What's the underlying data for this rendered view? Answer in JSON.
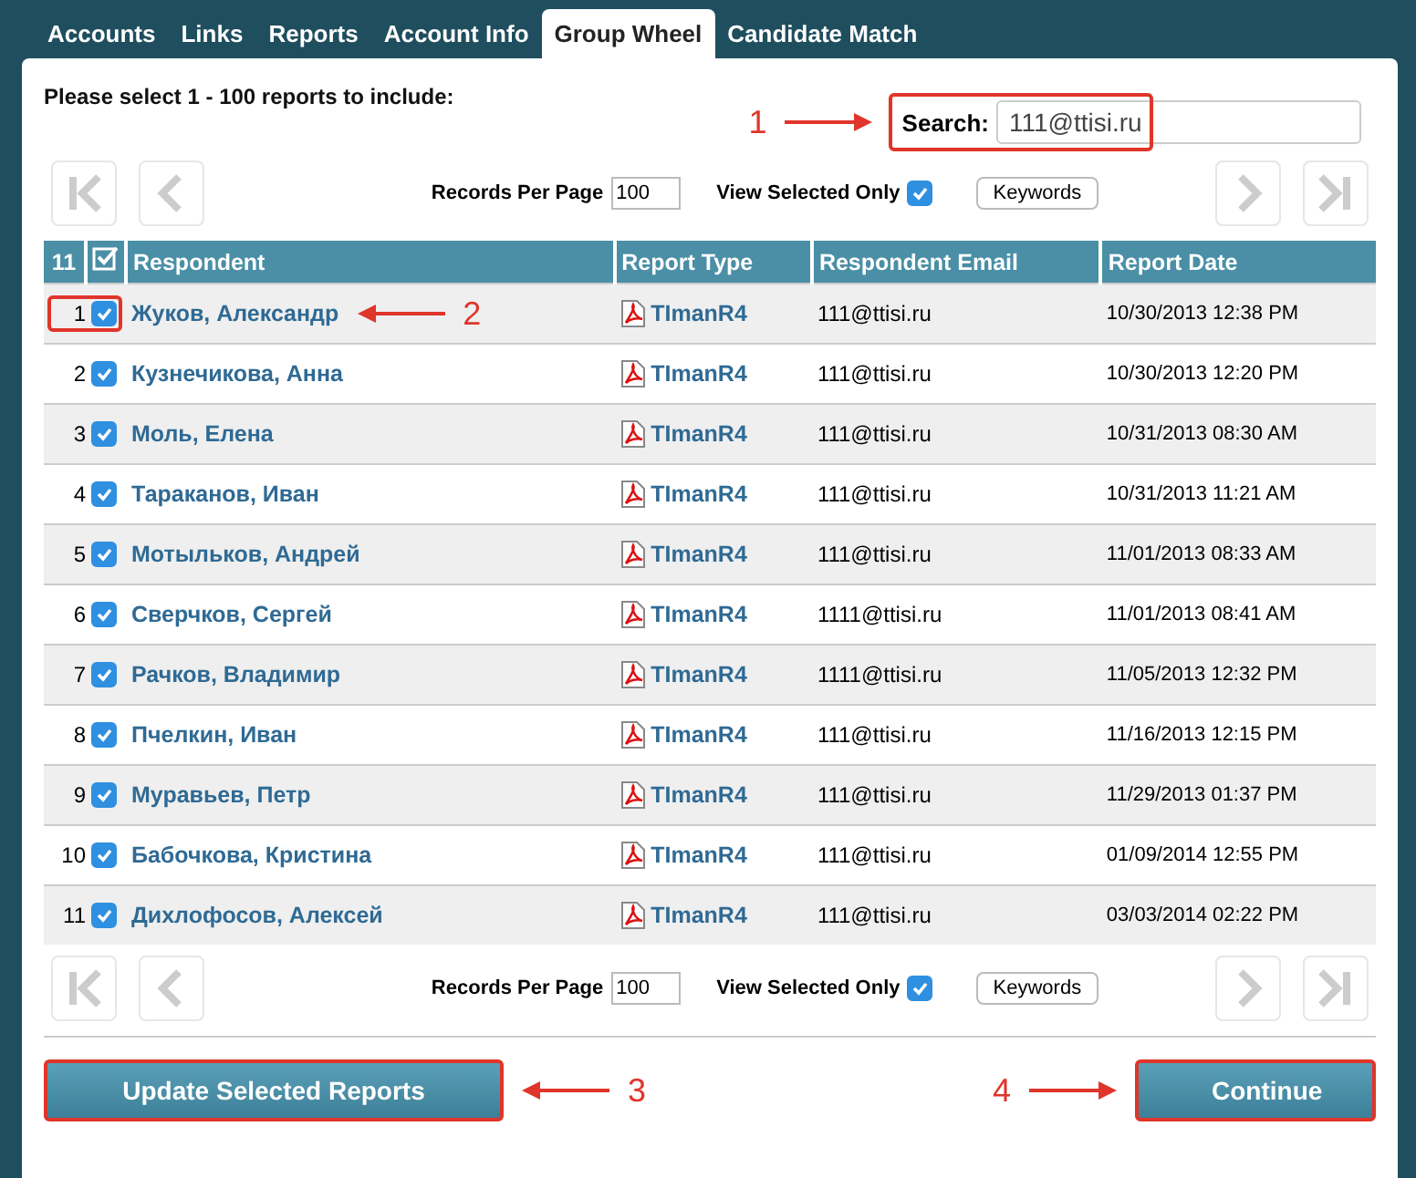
{
  "tabs": [
    {
      "label": "Accounts",
      "selected": false
    },
    {
      "label": "Links",
      "selected": false
    },
    {
      "label": "Reports",
      "selected": false
    },
    {
      "label": "Account Info",
      "selected": false
    },
    {
      "label": "Group Wheel",
      "selected": true
    },
    {
      "label": "Candidate Match",
      "selected": false
    }
  ],
  "instruction": "Please select 1 - 100 reports to include:",
  "search": {
    "label": "Search:",
    "value": "111@ttisi.ru",
    "highlighted": true,
    "callout": "1"
  },
  "pagers": [
    {
      "records_label": "Records Per Page",
      "records_value": "100",
      "view_selected_label": "View Selected Only",
      "view_selected_checked": true,
      "keywords_button": "Keywords"
    },
    {
      "records_label": "Records Per Page",
      "records_value": "100",
      "view_selected_label": "View Selected Only",
      "view_selected_checked": true,
      "keywords_button": "Keywords"
    }
  ],
  "table": {
    "count": "11",
    "all_checked": true,
    "columns": [
      "Respondent",
      "Report Type",
      "Respondent Email",
      "Report Date"
    ],
    "rows": [
      {
        "number": "1",
        "checked": true,
        "respondent": "Жуков, Александр",
        "report_type": "TImanR4",
        "email": "111@ttisi.ru",
        "date": "10/30/2013 12:38 PM",
        "highlighted": true,
        "callout": "2"
      },
      {
        "number": "2",
        "checked": true,
        "respondent": "Кузнечикова, Анна",
        "report_type": "TImanR4",
        "email": "111@ttisi.ru",
        "date": "10/30/2013 12:20 PM",
        "highlighted": false
      },
      {
        "number": "3",
        "checked": true,
        "respondent": "Моль, Елена",
        "report_type": "TImanR4",
        "email": "111@ttisi.ru",
        "date": "10/31/2013 08:30 AM",
        "highlighted": false
      },
      {
        "number": "4",
        "checked": true,
        "respondent": "Тараканов, Иван",
        "report_type": "TImanR4",
        "email": "111@ttisi.ru",
        "date": "10/31/2013 11:21 AM",
        "highlighted": false
      },
      {
        "number": "5",
        "checked": true,
        "respondent": "Мотыльков, Андрей",
        "report_type": "TImanR4",
        "email": "111@ttisi.ru",
        "date": "11/01/2013 08:33 AM",
        "highlighted": false
      },
      {
        "number": "6",
        "checked": true,
        "respondent": "Сверчков, Сергей",
        "report_type": "TImanR4",
        "email": "1111@ttisi.ru",
        "date": "11/01/2013 08:41 AM",
        "highlighted": false
      },
      {
        "number": "7",
        "checked": true,
        "respondent": "Рачков, Владимир",
        "report_type": "TImanR4",
        "email": "1111@ttisi.ru",
        "date": "11/05/2013 12:32 PM",
        "highlighted": false
      },
      {
        "number": "8",
        "checked": true,
        "respondent": "Пчелкин, Иван",
        "report_type": "TImanR4",
        "email": "111@ttisi.ru",
        "date": "11/16/2013 12:15 PM",
        "highlighted": false
      },
      {
        "number": "9",
        "checked": true,
        "respondent": "Муравьев, Петр",
        "report_type": "TImanR4",
        "email": "111@ttisi.ru",
        "date": "11/29/2013 01:37 PM",
        "highlighted": false
      },
      {
        "number": "10",
        "checked": true,
        "respondent": "Бабочкова, Кристина",
        "report_type": "TImanR4",
        "email": "111@ttisi.ru",
        "date": "01/09/2014 12:55 PM",
        "highlighted": false
      },
      {
        "number": "11",
        "checked": true,
        "respondent": "Дихлофосов, Алексей",
        "report_type": "TImanR4",
        "email": "111@ttisi.ru",
        "date": "03/03/2014 02:22 PM",
        "highlighted": false
      }
    ]
  },
  "buttons": [
    {
      "label": "Update Selected Reports",
      "highlighted": true,
      "callout": "3"
    },
    {
      "label": "Continue",
      "highlighted": true,
      "callout": "4"
    }
  ]
}
